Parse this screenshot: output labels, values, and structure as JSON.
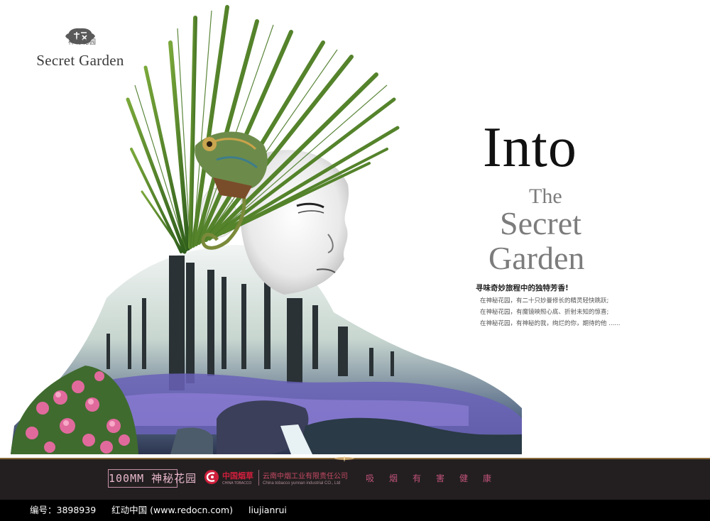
{
  "logo": {
    "emblem_icon": "garden-emblem-icon",
    "name_en": "Secret Garden",
    "name_cn": "神秘花园"
  },
  "headline": {
    "into": "Into",
    "the": "The",
    "secret": "Secret",
    "garden": "Garden"
  },
  "slogan": "寻味奇妙旅程中的独特芳香!",
  "body_lines": [
    "在神秘花园，有二十只妙曼修长的精灵轻快跳跃;",
    "在神秘花园，有魔镜映照心底、折射未知的惊喜;",
    "在神秘花园，有神秘的我，绚烂的你，期待的他 ......"
  ],
  "band": {
    "brand_mark": "100MM 神秘花园",
    "company_logo_icon": "china-tobacco-logo-icon",
    "company_name": "中国烟草",
    "company_name_en": "CHINA TOBACCO",
    "company_full": "云南中烟工业有限责任公司",
    "company_full_en": "China tobacco yunnan industrial CO., Ltd",
    "warning": "吸烟有害健康"
  },
  "footer": {
    "id": "编号：3898939",
    "site": "红动中国 (www.redocn.com)",
    "author": "liujianrui"
  },
  "colors": {
    "band_bg": "#231f20",
    "brand_red": "#d01f3c",
    "warning_pink": "#c0527a",
    "footer_bg": "#000000"
  }
}
